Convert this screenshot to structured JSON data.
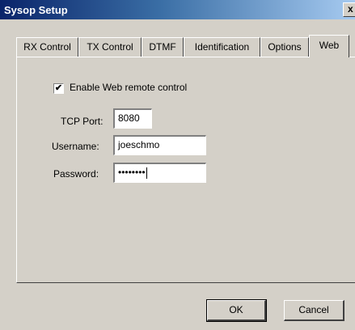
{
  "window": {
    "title": "Sysop Setup",
    "close_label": "x"
  },
  "tabs": [
    {
      "label": "RX Control"
    },
    {
      "label": "TX Control"
    },
    {
      "label": "DTMF"
    },
    {
      "label": "Identification"
    },
    {
      "label": "Options"
    },
    {
      "label": "Web"
    }
  ],
  "active_tab": "Web",
  "web": {
    "enable_label": "Enable Web remote control",
    "enable_checked": true,
    "check_mark": "✔",
    "tcp_port_label": "TCP Port:",
    "tcp_port_value": "8080",
    "username_label": "Username:",
    "username_value": "joeschmo",
    "password_label": "Password:",
    "password_value": "••••••••"
  },
  "buttons": {
    "ok": "OK",
    "cancel": "Cancel"
  }
}
